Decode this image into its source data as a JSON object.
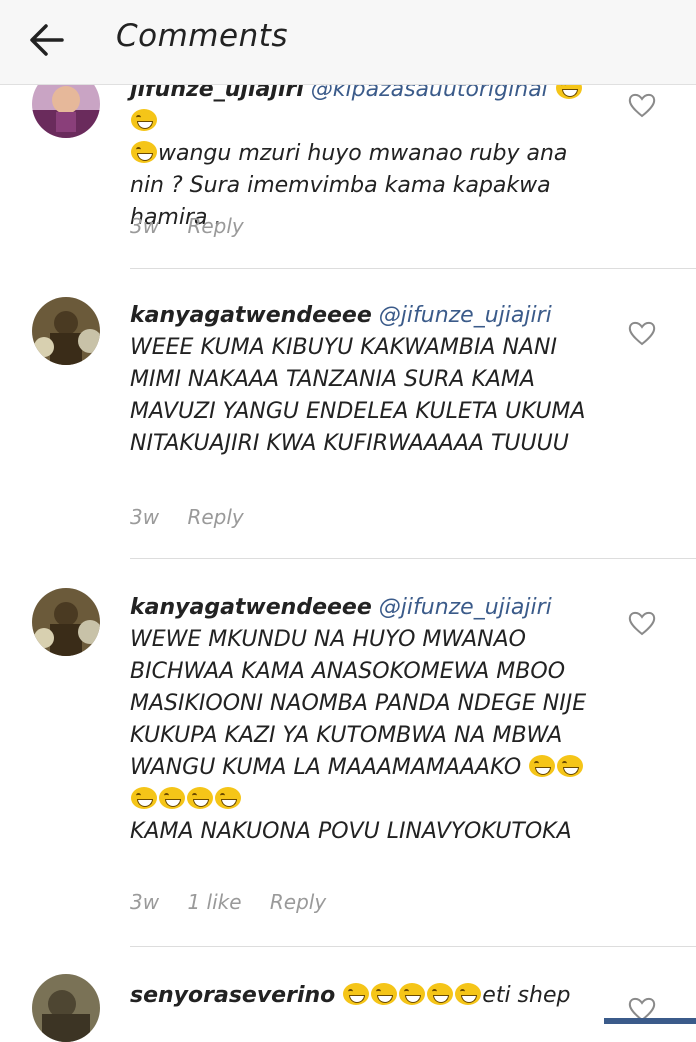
{
  "header": {
    "title": "Comments",
    "back_icon": "arrow-left-icon"
  },
  "comments": [
    {
      "username": "jifunze_ujiajiri",
      "mention": "@kipazasauutoriginal",
      "text": "wangu  mzuri huyo mwanao ruby ana nin ?  Sura imemvimba kama kapakwa hamira .",
      "time": "3w",
      "likes": "",
      "reply_label": "Reply"
    },
    {
      "username": "kanyagatwendeeee",
      "mention": "@jifunze_ujiajiri",
      "text": "WEEE KUMA KIBUYU KAKWAMBIA NANI MIMI NAKAAA TANZANIA SURA KAMA MAVUZI YANGU ENDELEA KULETA UKUMA NITAKUAJIRI KWA KUFIRWAAAAA TUUUU",
      "time": "3w",
      "likes": "",
      "reply_label": "Reply"
    },
    {
      "username": "kanyagatwendeeee",
      "mention": "@jifunze_ujiajiri",
      "text_a": "WEWE MKUNDU NA HUYO MWANAO BICHWAA KAMA ANASOKOMEWA MBOO MASIKIOONI NAOMBA PANDA NDEGE NIJE KUKUPA KAZI YA KUTOMBWA  NA MBWA WANGU KUMA LA MAAAMAMAAAKO",
      "text_b": "KAMA NAKUONA POVU LINAVYOKUTOKA",
      "time": "3w",
      "likes": "1 like",
      "reply_label": "Reply"
    },
    {
      "username": "senyoraseverino",
      "text": "eti shep",
      "time": "",
      "likes": "",
      "reply_label": ""
    }
  ],
  "colors": {
    "mention": "#3b5b8a",
    "meta": "#9a9a9a",
    "emoji": "#f5c518"
  }
}
